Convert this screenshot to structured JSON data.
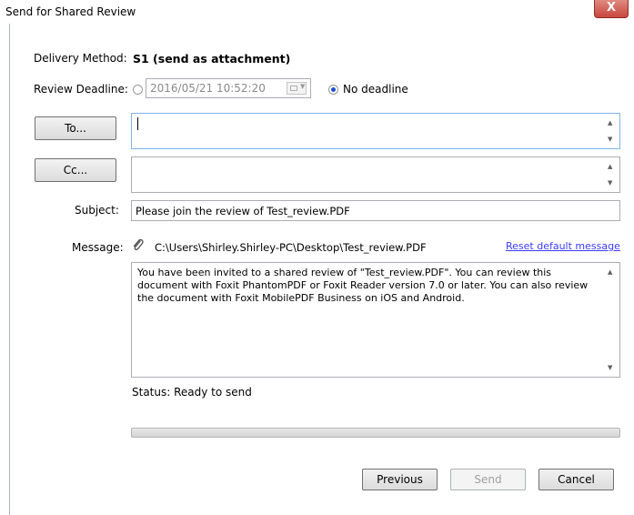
{
  "window": {
    "title": "Send for Shared Review",
    "close_label": "X"
  },
  "form": {
    "delivery_label": "Delivery Method:",
    "delivery_value": "S1 (send as attachment)",
    "deadline_label": "Review Deadline:",
    "deadline_value": "2016/05/21  10:52:20",
    "deadline_selected": false,
    "no_deadline_label": "No deadline",
    "no_deadline_selected": true,
    "to_button": "To...",
    "to_value": "",
    "cc_button": "Cc...",
    "cc_value": "",
    "subject_label": "Subject:",
    "subject_value": "Please join the review of Test_review.PDF",
    "message_label": "Message:",
    "attachment_path": "C:\\Users\\Shirley.Shirley-PC\\Desktop\\Test_review.PDF",
    "reset_link": "Reset default message",
    "message_text": "You have been invited to a shared review of \"Test_review.PDF\". You can review this document with Foxit PhantomPDF or Foxit Reader version 7.0 or later. You can also review the document with Foxit MobilePDF Business on iOS and Android.",
    "status_text": "Status: Ready to send"
  },
  "buttons": {
    "previous": "Previous",
    "send": "Send",
    "cancel": "Cancel"
  },
  "icons": {
    "attachment": "paperclip-icon",
    "calendar": "calendar-icon"
  }
}
